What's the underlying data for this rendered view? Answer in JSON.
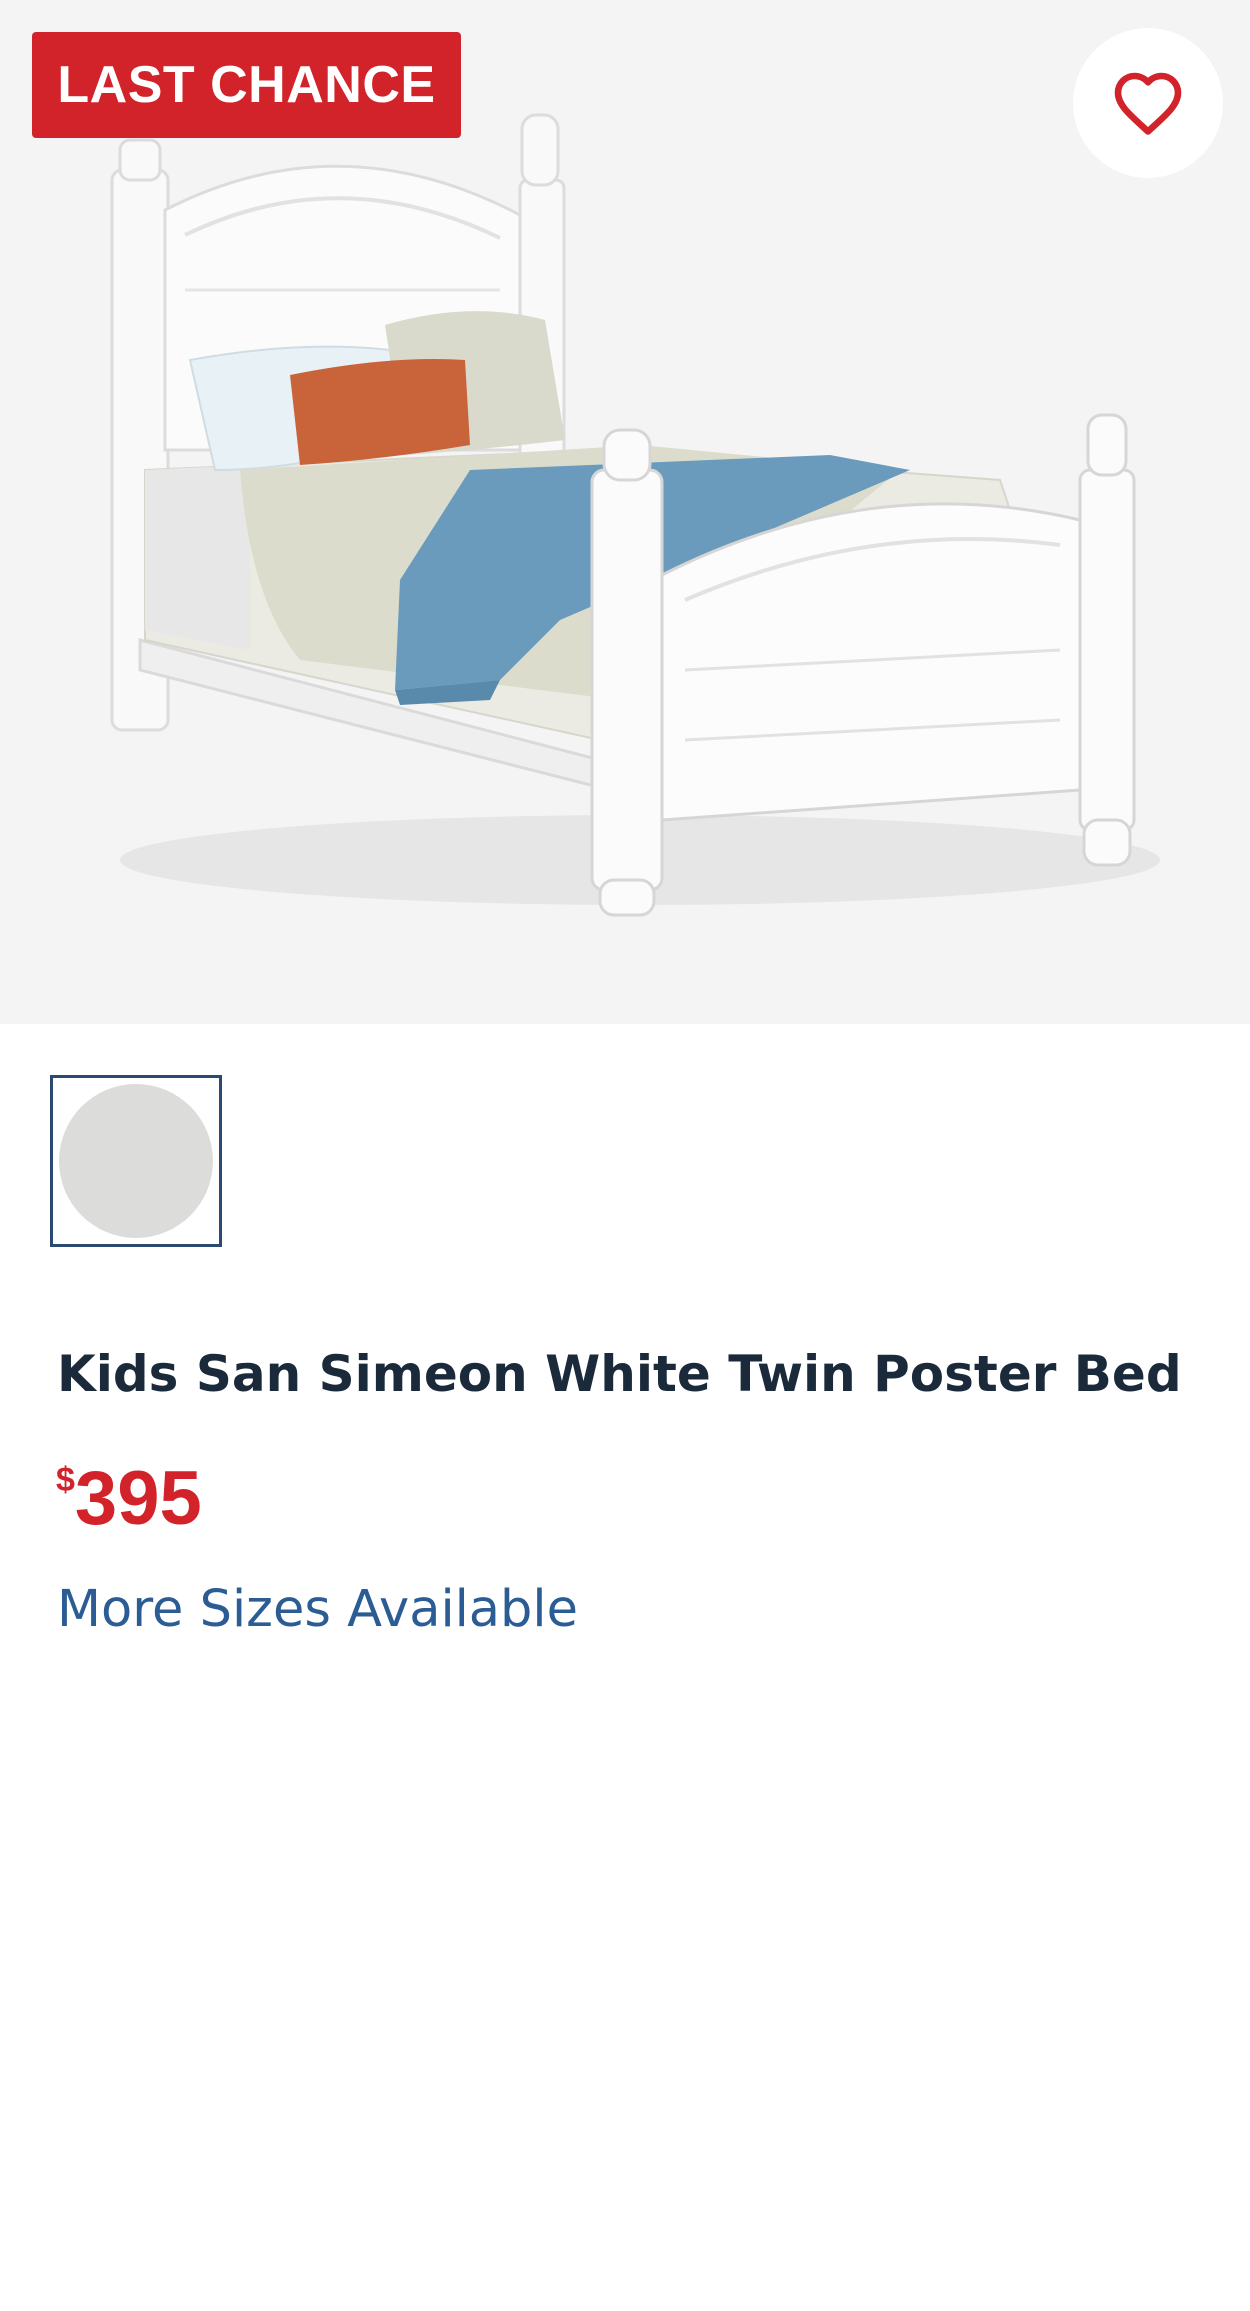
{
  "badge": {
    "label": "LAST CHANCE"
  },
  "favorite": {
    "icon": "heart-outline-icon",
    "color": "#d2232a"
  },
  "product": {
    "image_alt": "Kids San Simeon White Twin Poster Bed",
    "swatches": [
      {
        "color": "#dcdcdb",
        "selected": true
      }
    ],
    "title": "Kids San Simeon White Twin Poster Bed",
    "price": {
      "currency": "$",
      "amount": "395"
    },
    "more_sizes_label": "More Sizes Available"
  },
  "colors": {
    "accent_red": "#d2232a",
    "link_blue": "#2b5c93",
    "title_navy": "#1b2a3a"
  }
}
